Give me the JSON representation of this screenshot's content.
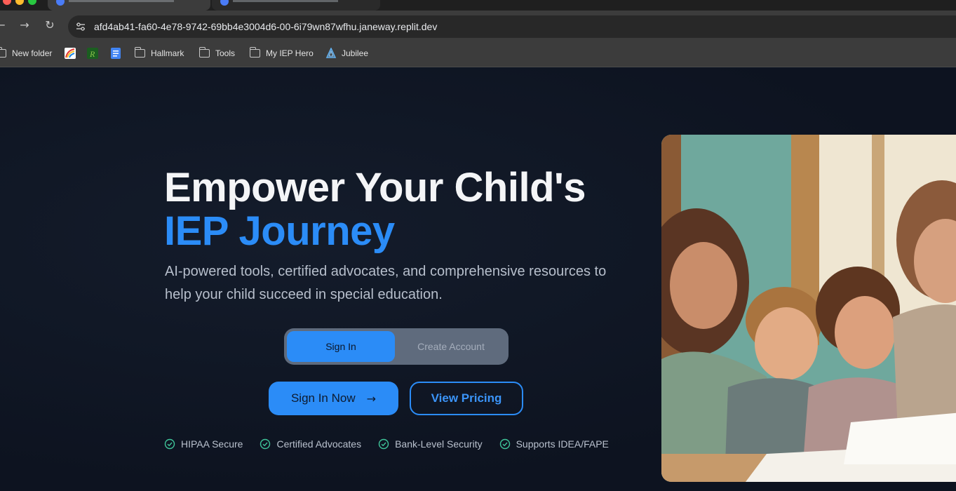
{
  "browser": {
    "url": "afd4ab41-fa60-4e78-9742-69bb4e3004d6-00-6i79wn87wfhu.janeway.replit.dev",
    "bookmarks": [
      {
        "label": "New folder",
        "icon": "folder-icon"
      },
      {
        "label": "",
        "icon": "colorful-app-icon"
      },
      {
        "label": "",
        "icon": "r-app-icon"
      },
      {
        "label": "",
        "icon": "docs-icon"
      },
      {
        "label": "Hallmark",
        "icon": "folder-icon"
      },
      {
        "label": "Tools",
        "icon": "folder-icon"
      },
      {
        "label": "My IEP Hero",
        "icon": "folder-icon"
      },
      {
        "label": "Jubilee",
        "icon": "jubilee-icon"
      }
    ]
  },
  "hero": {
    "title_line1": "Empower Your Child's",
    "title_line2": "IEP Journey",
    "subtitle": "AI-powered tools, certified advocates, and comprehensive resources to help your child succeed in special education.",
    "toggle": {
      "selected": "Sign In",
      "other": "Create Account"
    },
    "primary_button": "Sign In Now",
    "secondary_button": "View Pricing",
    "features": [
      "HIPAA Secure",
      "Certified Advocates",
      "Bank-Level Security",
      "Supports IDEA/FAPE"
    ]
  },
  "colors": {
    "accent": "#2b8cf7",
    "background": "#0f1623",
    "check": "#3fc59a"
  }
}
